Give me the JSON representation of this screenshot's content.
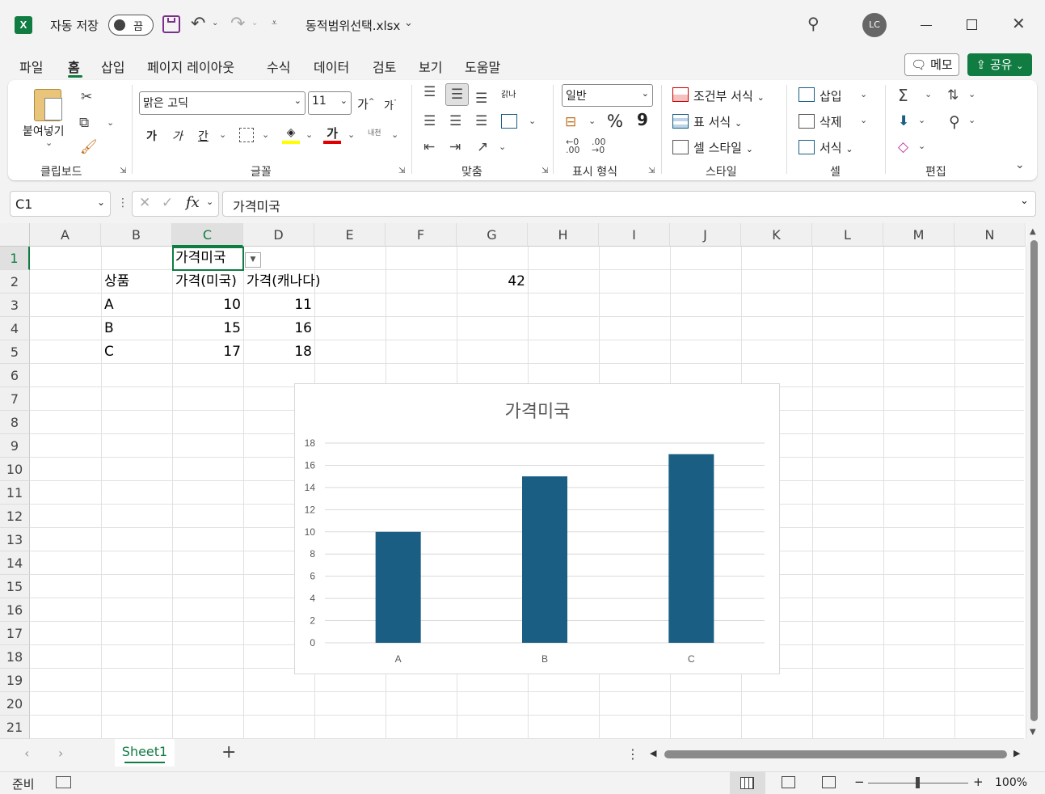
{
  "titlebar": {
    "logo": "X",
    "autosave_label": "자동 저장",
    "autosave_state": "끔",
    "filename": "동적범위선택.xlsx",
    "avatar_initials": "LC",
    "icons": [
      "save-icon",
      "undo-icon",
      "redo-icon",
      "customize-icon",
      "search-icon",
      "minimize-icon",
      "maximize-icon",
      "close-icon"
    ]
  },
  "menu": {
    "items": [
      "파일",
      "홈",
      "삽입",
      "페이지 레이아웃",
      "수식",
      "데이터",
      "검토",
      "보기",
      "도움말"
    ],
    "active": "홈",
    "memo_label": "메모",
    "share_label": "공유"
  },
  "ribbon": {
    "clipboard": {
      "paste_label": "붙여넣기",
      "group_label": "클립보드"
    },
    "font": {
      "font_name": "맑은 고딕",
      "font_size": "11",
      "grow": "가",
      "shrink": "가",
      "bold": "가",
      "italic": "가",
      "underline": "간",
      "font_color_glyph": "가",
      "phonetic": "내천",
      "group_label": "글꼴"
    },
    "alignment": {
      "group_label": "맞춤",
      "wrap_glyph": "갉나"
    },
    "number": {
      "format": "일반",
      "percent": "%",
      "comma": "9",
      "group_label": "표시 형식"
    },
    "styles": {
      "conditional": "조건부 서식",
      "table": "표 서식",
      "cell_style": "셀 스타일",
      "group_label": "스타일"
    },
    "cells": {
      "insert": "삽입",
      "delete": "삭제",
      "format": "서식",
      "group_label": "셀"
    },
    "editing": {
      "group_label": "편집"
    }
  },
  "formula_bar": {
    "name_box": "C1",
    "fx": "fx",
    "formula": "가격미국"
  },
  "sheet": {
    "columns": [
      "A",
      "B",
      "C",
      "D",
      "E",
      "F",
      "G",
      "H",
      "I",
      "J",
      "K",
      "L",
      "M",
      "N"
    ],
    "selected_column": "C",
    "rows": [
      "1",
      "2",
      "3",
      "4",
      "5",
      "6",
      "7",
      "8",
      "9",
      "10",
      "11",
      "12",
      "13",
      "14",
      "15",
      "16",
      "17",
      "18",
      "19",
      "20",
      "21"
    ],
    "selected_row": "1",
    "cells": {
      "C1": "가격미국",
      "B2": "상품",
      "C2": "가격(미국)",
      "D2": "가격(캐나다)",
      "G2": "42",
      "B3": "A",
      "C3": "10",
      "D3": "11",
      "B4": "B",
      "C4": "15",
      "D4": "16",
      "B5": "C",
      "C5": "17",
      "D5": "18"
    }
  },
  "chart_data": {
    "type": "bar",
    "title": "가격미국",
    "categories": [
      "A",
      "B",
      "C"
    ],
    "series": [
      {
        "values": [
          10,
          15,
          17
        ]
      }
    ],
    "ylim": [
      0,
      18
    ],
    "yticks": [
      0,
      2,
      4,
      6,
      8,
      10,
      12,
      14,
      16,
      18
    ],
    "grid": true,
    "color": "#1a5e84"
  },
  "tabs": {
    "sheets": [
      "Sheet1"
    ],
    "add": "+"
  },
  "status": {
    "ready": "준비",
    "zoom": "100%"
  }
}
